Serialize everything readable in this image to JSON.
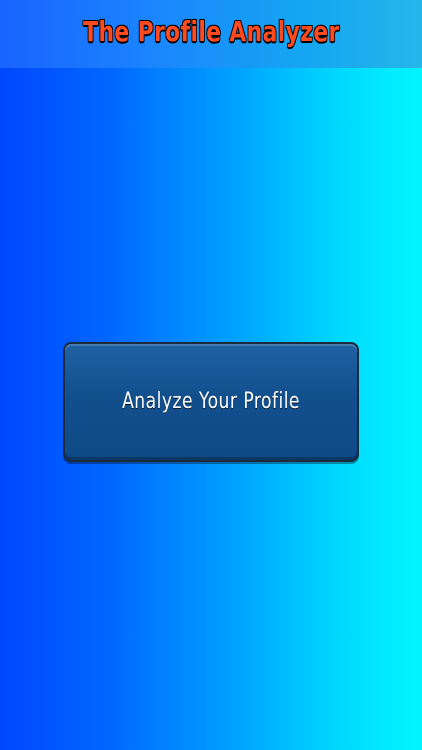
{
  "header": {
    "title": "The Profile Analyzer"
  },
  "main": {
    "analyze_button_label": "Analyze Your Profile"
  },
  "colors": {
    "background_left": "#0047ff",
    "background_right": "#00f6ff",
    "header_bar": "#1b84ff",
    "title_text": "#ff4b1f",
    "button_fill": "#124f8d",
    "button_text": "#ffffff"
  }
}
